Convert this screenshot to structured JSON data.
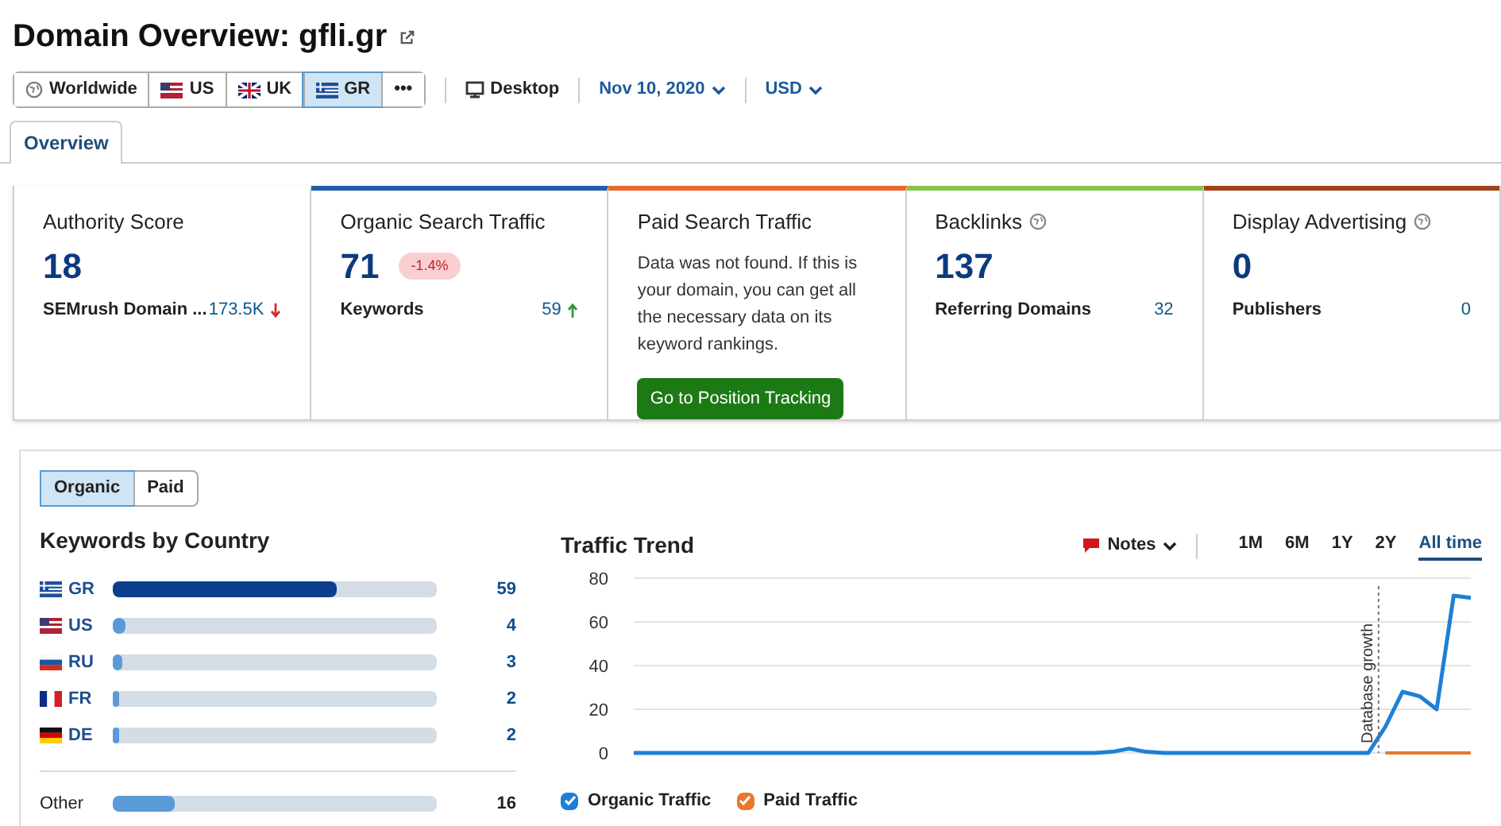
{
  "title": "Domain Overview: gfli.gr",
  "databases": [
    {
      "label": "Worldwide",
      "kind": "globe",
      "selected": false
    },
    {
      "label": "US",
      "kind": "usa",
      "selected": false
    },
    {
      "label": "UK",
      "kind": "uk",
      "selected": false
    },
    {
      "label": "GR",
      "kind": "greece",
      "selected": true
    },
    {
      "label": "•••",
      "kind": "more",
      "selected": false
    }
  ],
  "device": "Desktop",
  "date": "Nov 10, 2020",
  "currency": "USD",
  "tabs": [
    {
      "label": "Overview",
      "selected": true
    }
  ],
  "cards": [
    {
      "title": "Authority Score",
      "value": "18",
      "sub_label": "SEMrush Domain ...",
      "sub_value": "173.5K",
      "rising": false
    },
    {
      "title": "Organic Search Traffic",
      "color": "#1f5fa8",
      "value": "71",
      "badge": "-1.4%",
      "sub_label": "Keywords",
      "sub_value": "59",
      "rising": true
    },
    {
      "title": "Paid Search Traffic",
      "color": "#e8692c",
      "message": "Data was not found. If this is your domain, you can get all the necessary data on its keyword rankings.",
      "button": "Go to Position Tracking"
    },
    {
      "title": "Backlinks",
      "info": true,
      "color": "#8bc34a",
      "value": "137",
      "sub_label": "Referring Domains",
      "sub_value": "32"
    },
    {
      "title": "Display Advertising",
      "info": true,
      "color": "#a0441c",
      "value": "0",
      "sub_label": "Publishers",
      "sub_value": "0"
    }
  ],
  "traffic_toggle": [
    {
      "label": "Organic",
      "selected": true
    },
    {
      "label": "Paid",
      "selected": false
    }
  ],
  "keywords_by_country": {
    "title": "Keywords by Country",
    "rows": [
      {
        "kind": "greece",
        "code": "GR",
        "level": 0.69,
        "count": "59",
        "selected": true
      },
      {
        "kind": "usa",
        "code": "US",
        "level": 0.04,
        "count": "4",
        "selected": false
      },
      {
        "kind": "russia",
        "code": "RU",
        "level": 0.03,
        "count": "3",
        "selected": false
      },
      {
        "kind": "france",
        "code": "FR",
        "level": 0.02,
        "count": "2",
        "selected": false
      },
      {
        "kind": "germany",
        "code": "DE",
        "level": 0.02,
        "count": "2",
        "selected": false
      }
    ],
    "other": {
      "code": "Other",
      "level": 0.19,
      "count": "16"
    }
  },
  "traffic_trend": {
    "title": "Traffic Trend",
    "notes": "Notes",
    "ranges": [
      {
        "label": "1M",
        "selected": false
      },
      {
        "label": "6M",
        "selected": false
      },
      {
        "label": "1Y",
        "selected": false
      },
      {
        "label": "2Y",
        "selected": false
      },
      {
        "label": "All time",
        "selected": true
      }
    ],
    "chart_data": {
      "type": "line",
      "grid": true,
      "ylim": [
        0,
        80
      ],
      "yticks": [
        0,
        20,
        40,
        60,
        80
      ],
      "series": [
        {
          "name": "Organic Traffic",
          "color": "#1e7fd6",
          "values": [
            0,
            0,
            0,
            0,
            0,
            0,
            0,
            0,
            0,
            0,
            0,
            0,
            0,
            0,
            0,
            0,
            0,
            0,
            0,
            0,
            0,
            0,
            0,
            0,
            0,
            0,
            0,
            0,
            0.5,
            2,
            0.5,
            0,
            0,
            0,
            0,
            0,
            0,
            0,
            0,
            0,
            0,
            0,
            0,
            0,
            12,
            28,
            26,
            20,
            72,
            71
          ]
        },
        {
          "name": "Paid Traffic",
          "color": "#e8772e",
          "values": [
            null,
            null,
            null,
            null,
            null,
            null,
            null,
            null,
            null,
            null,
            null,
            null,
            null,
            null,
            null,
            null,
            null,
            null,
            null,
            null,
            null,
            null,
            null,
            null,
            null,
            null,
            null,
            null,
            null,
            null,
            null,
            null,
            null,
            null,
            null,
            null,
            null,
            null,
            null,
            null,
            null,
            null,
            null,
            null,
            0,
            0,
            0,
            0,
            0,
            0
          ]
        }
      ],
      "annotations": [
        "Database growth"
      ]
    },
    "legend": [
      {
        "checked": true
      },
      {
        "checked": true
      }
    ]
  }
}
